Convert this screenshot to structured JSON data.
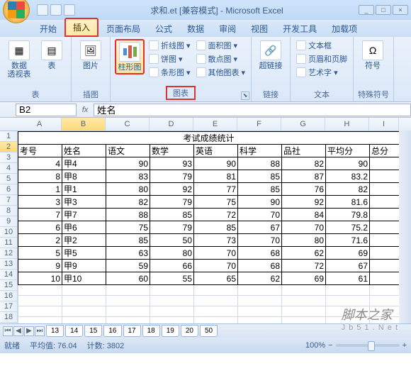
{
  "title": "求和.et [兼容模式] - Microsoft Excel",
  "tabs": [
    "开始",
    "插入",
    "页面布局",
    "公式",
    "数据",
    "审阅",
    "视图",
    "开发工具",
    "加载项"
  ],
  "active_tab": 1,
  "ribbon": {
    "g1": {
      "label": "表",
      "btn": "数据\n透视表",
      "btn2": "表"
    },
    "g2": {
      "label": "插图",
      "btn": "图片"
    },
    "g3": {
      "label": "图表",
      "btn": "柱形图",
      "items": [
        "折线图",
        "饼图",
        "条形图",
        "面积图",
        "散点图",
        "其他图表"
      ]
    },
    "g4": {
      "label": "链接",
      "btn": "超链接"
    },
    "g5": {
      "label": "文本",
      "items": [
        "文本框",
        "页眉和页脚",
        "艺术字"
      ]
    },
    "g6": {
      "label": "特殊符号",
      "btn": "符号"
    }
  },
  "namebox": "B2",
  "formula": "姓名",
  "columns": [
    "A",
    "B",
    "C",
    "D",
    "E",
    "F",
    "G",
    "H",
    "I"
  ],
  "merged_title": "考试成绩统计",
  "headers": [
    "考号",
    "姓名",
    "语文",
    "数学",
    "英语",
    "科学",
    "品社",
    "平均分",
    "总分"
  ],
  "rows": [
    [
      "4",
      "甲4",
      "90",
      "93",
      "90",
      "88",
      "82",
      "90",
      ""
    ],
    [
      "8",
      "甲8",
      "83",
      "79",
      "81",
      "85",
      "87",
      "83.2",
      ""
    ],
    [
      "1",
      "甲1",
      "80",
      "92",
      "77",
      "85",
      "76",
      "82",
      ""
    ],
    [
      "3",
      "甲3",
      "82",
      "79",
      "75",
      "90",
      "92",
      "81.6",
      ""
    ],
    [
      "7",
      "甲7",
      "88",
      "85",
      "72",
      "70",
      "84",
      "79.8",
      ""
    ],
    [
      "6",
      "甲6",
      "75",
      "79",
      "85",
      "67",
      "70",
      "75.2",
      ""
    ],
    [
      "2",
      "甲2",
      "85",
      "50",
      "73",
      "70",
      "80",
      "71.6",
      ""
    ],
    [
      "5",
      "甲5",
      "63",
      "80",
      "70",
      "68",
      "62",
      "69",
      ""
    ],
    [
      "9",
      "甲9",
      "59",
      "66",
      "70",
      "68",
      "72",
      "67",
      ""
    ],
    [
      "10",
      "甲10",
      "60",
      "55",
      "65",
      "62",
      "69",
      "61",
      ""
    ]
  ],
  "sheets_nav": [
    "◂",
    "◂",
    "▸",
    "▸"
  ],
  "sheets": [
    "13",
    "14",
    "15",
    "16",
    "17",
    "18",
    "19",
    "20",
    "50"
  ],
  "status": {
    "ready": "就绪",
    "avg": "平均值: 76.04",
    "count": "计数: 3802",
    "zoom": "100%"
  },
  "watermark": {
    "line1": "脚本之家",
    "line2": "J b 5 1 . N e t"
  },
  "chart_data": {
    "type": "table",
    "title": "考试成绩统计",
    "columns": [
      "考号",
      "姓名",
      "语文",
      "数学",
      "英语",
      "科学",
      "品社",
      "平均分"
    ],
    "rows": [
      [
        4,
        "甲4",
        90,
        93,
        90,
        88,
        82,
        90
      ],
      [
        8,
        "甲8",
        83,
        79,
        81,
        85,
        87,
        83.2
      ],
      [
        1,
        "甲1",
        80,
        92,
        77,
        85,
        76,
        82
      ],
      [
        3,
        "甲3",
        82,
        79,
        75,
        90,
        92,
        81.6
      ],
      [
        7,
        "甲7",
        88,
        85,
        72,
        70,
        84,
        79.8
      ],
      [
        6,
        "甲6",
        75,
        79,
        85,
        67,
        70,
        75.2
      ],
      [
        2,
        "甲2",
        85,
        50,
        73,
        70,
        80,
        71.6
      ],
      [
        5,
        "甲5",
        63,
        80,
        70,
        68,
        62,
        69
      ],
      [
        9,
        "甲9",
        59,
        66,
        70,
        68,
        72,
        67
      ],
      [
        10,
        "甲10",
        60,
        55,
        65,
        62,
        69,
        61
      ]
    ]
  }
}
